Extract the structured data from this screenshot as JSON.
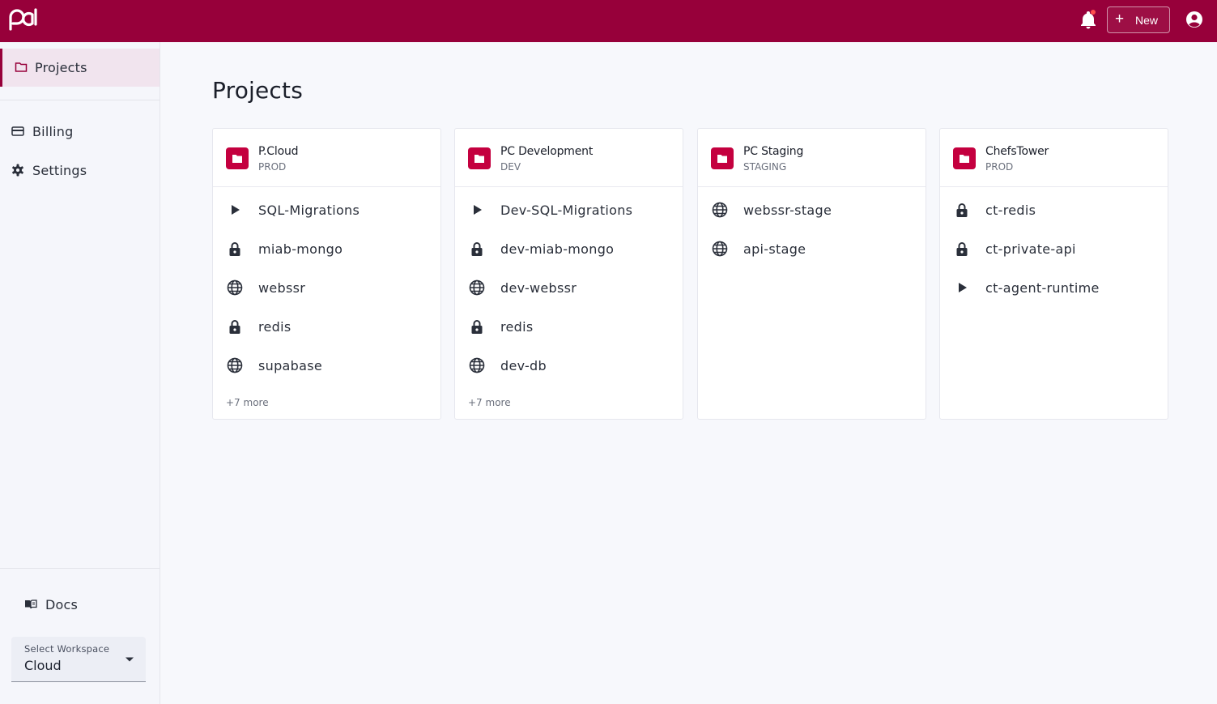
{
  "topbar": {
    "new_label": "New",
    "colors": {
      "brand": "#97003a",
      "accent": "#c4003f"
    },
    "icons": {
      "logo": "pa-logo-icon",
      "bell": "bell-icon",
      "plus": "plus-icon",
      "account": "account-circle-icon"
    }
  },
  "sidebar": {
    "items": [
      {
        "label": "Projects",
        "icon": "folder-outline-icon",
        "active": true
      },
      {
        "label": "Billing",
        "icon": "credit-card-icon"
      },
      {
        "label": "Settings",
        "icon": "gear-icon"
      }
    ],
    "docs_label": "Docs",
    "workspace": {
      "label": "Select Workspace",
      "value": "Cloud"
    }
  },
  "main": {
    "title": "Projects",
    "projects": [
      {
        "name": "P.Cloud",
        "env": "PROD",
        "services": [
          {
            "name": "SQL-Migrations",
            "icon": "play-icon"
          },
          {
            "name": "miab-mongo",
            "icon": "lock-icon"
          },
          {
            "name": "webssr",
            "icon": "globe-icon"
          },
          {
            "name": "redis",
            "icon": "lock-icon"
          },
          {
            "name": "supabase",
            "icon": "globe-icon"
          }
        ],
        "more": "+7 more"
      },
      {
        "name": "PC Development",
        "env": "DEV",
        "services": [
          {
            "name": "Dev-SQL-Migrations",
            "icon": "play-icon"
          },
          {
            "name": "dev-miab-mongo",
            "icon": "lock-icon"
          },
          {
            "name": "dev-webssr",
            "icon": "globe-icon"
          },
          {
            "name": "redis",
            "icon": "lock-icon"
          },
          {
            "name": "dev-db",
            "icon": "globe-icon"
          }
        ],
        "more": "+7 more"
      },
      {
        "name": "PC Staging",
        "env": "STAGING",
        "services": [
          {
            "name": "webssr-stage",
            "icon": "globe-icon"
          },
          {
            "name": "api-stage",
            "icon": "globe-icon"
          }
        ]
      },
      {
        "name": "ChefsTower",
        "env": "PROD",
        "services": [
          {
            "name": "ct-redis",
            "icon": "lock-icon"
          },
          {
            "name": "ct-private-api",
            "icon": "lock-icon"
          },
          {
            "name": "ct-agent-runtime",
            "icon": "play-icon"
          }
        ]
      }
    ]
  }
}
